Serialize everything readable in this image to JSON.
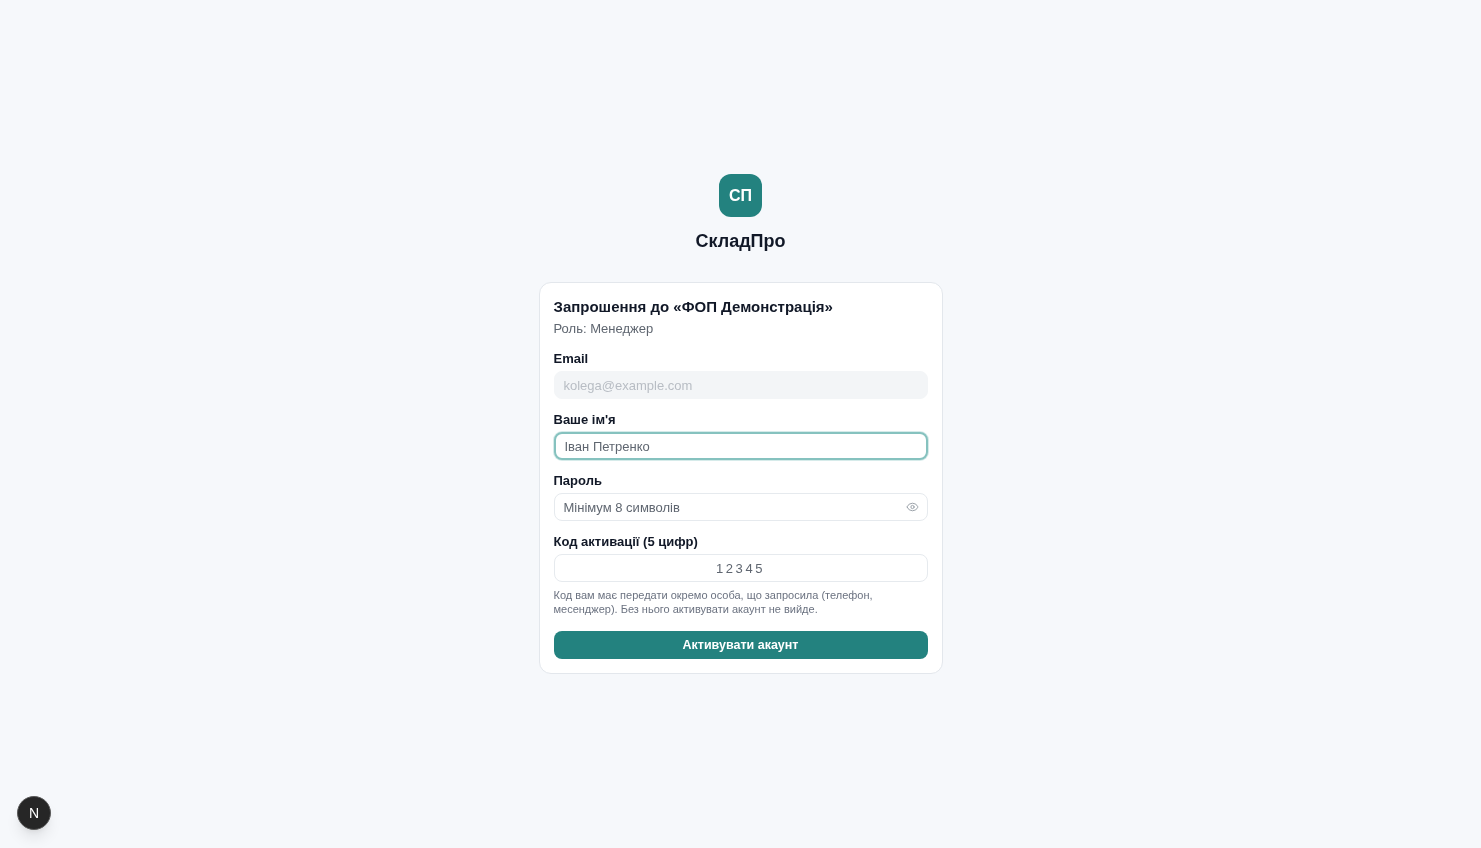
{
  "brand": {
    "logo": "СП",
    "name": "СкладПро"
  },
  "card": {
    "title": "Запрошення до «ФОП Демонстрація»",
    "subtitle": "Роль: Менеджер",
    "fields": [
      {
        "kind": "text",
        "label": "Email",
        "placeholder": "kolega@example.com",
        "disabled": true,
        "focused": false
      },
      {
        "kind": "text",
        "label": "Ваше ім'я",
        "placeholder": "Іван Петренко",
        "disabled": false,
        "focused": true
      },
      {
        "kind": "password",
        "label": "Пароль",
        "placeholder": "Мінімум 8 символів",
        "disabled": false,
        "focused": false
      },
      {
        "kind": "code",
        "label": "Код активації (5 цифр)",
        "placeholder": "12345",
        "disabled": false,
        "focused": false
      }
    ],
    "hint": "Код вам має передати окремо особа, що запросила (телефон, месенджер). Без нього активувати акаунт не вийде.",
    "submit": "Активувати акаунт"
  },
  "dev_badge": {
    "label": "N"
  }
}
